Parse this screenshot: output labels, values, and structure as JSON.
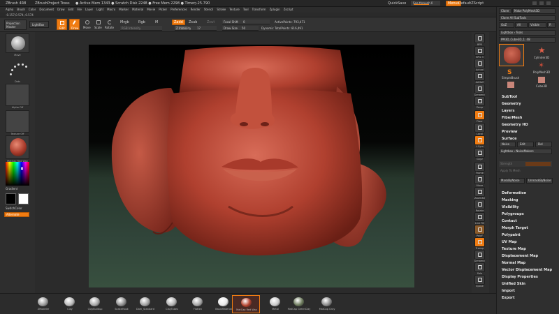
{
  "titlebar": {
    "app": "ZBrush 4R8",
    "project": "ZBrushProject Tosss",
    "stats": "● Active Mem 1343 ● Scratch Disk 2248 ● Free Mem 2298 ● Timer▷25.790",
    "quicksave": "QuickSave",
    "seethrough": "See-through 0",
    "menus_btn": "Menus",
    "defaultscript": "DefaultZScript"
  },
  "menubar": {
    "items": [
      "Alpha",
      "Brush",
      "Color",
      "Document",
      "Draw",
      "Edit",
      "File",
      "Layer",
      "Light",
      "Macro",
      "Marker",
      "Material",
      "Movie",
      "Picker",
      "Preferences",
      "Render",
      "Stencil",
      "Stroke",
      "Texture",
      "Tool",
      "Transform",
      "Zplugin",
      "Zscript"
    ],
    "coords": "-0.157,0.574,-0.574"
  },
  "toolbar": {
    "projection_master": "Projection Master",
    "lightbox": "LightBox",
    "edit": "Edit",
    "draw": "Draw",
    "move": "Move",
    "scale": "Scale",
    "rotate": "Rotate",
    "mrgb": "Mrgb",
    "rgb": "Rgb",
    "m": "M",
    "zadd": "Zadd",
    "zsub": "Zsub",
    "zcut": "Zcut",
    "rgb_intensity": "RGB Intensity",
    "z_intensity_label": "Z Intensity",
    "z_intensity_value": "17",
    "focal_shift_label": "Focal Shift",
    "focal_shift_value": "0",
    "draw_size_label": "Draw Size",
    "draw_size_value": "50",
    "dynamic": "Dynamic",
    "active_points": "ActivePoints: 793,471",
    "total_points": "TotalPoints: 816,491"
  },
  "left_panel": {
    "brush_label": "Move",
    "stroke_label": "Dots",
    "alpha_label": "Alpha Off",
    "texture_label": "Texture Off",
    "material_label": "MatCap Red Wax",
    "gradient": "Gradient",
    "switchcolor": "SwitchColor",
    "alternate": "Alternate"
  },
  "right_icons": [
    {
      "label": "BPR"
    },
    {
      "label": "SPix 3"
    },
    {
      "label": "Actual"
    },
    {
      "label": "AAHalf"
    },
    {
      "label": "Dynamic"
    },
    {
      "label": "Persp"
    },
    {
      "label": "Floor"
    },
    {
      "label": "Local"
    },
    {
      "label": "L.Sym"
    },
    {
      "label": "Gxyz"
    },
    {
      "label": "Frame"
    },
    {
      "label": "Move"
    },
    {
      "label": "Zoom3D"
    },
    {
      "label": "Rotate"
    },
    {
      "label": "Line Fill"
    },
    {
      "label": "PolyF"
    },
    {
      "label": "Transp"
    },
    {
      "label": "Dynamic"
    },
    {
      "label": "Solo"
    },
    {
      "label": "Xpose"
    }
  ],
  "tool_panel": {
    "clone": "Clone",
    "make_polymesh": "Make PolyMesh3D",
    "clone_all": "Clone All SubTools",
    "goz": "GoZ",
    "all": "All",
    "visible": "Visible",
    "r": "R",
    "lightbox_tools": "Lightbox › Tools",
    "current_tool": "PM3D_Cube3D_1. 48",
    "tool_thumbs": [
      "PM3D_Cube3D",
      "Cylinder3D",
      "PolyMesh3D",
      "SimpleBrush",
      "Cube3D",
      "PM3D_Cube3D"
    ]
  },
  "tool_menu": [
    "SubTool",
    "Geometry",
    "Layers",
    "FiberMesh",
    "Geometry HD",
    "Preview",
    "Surface"
  ],
  "surface_panel": {
    "noise": "Noise",
    "edit": "Edit",
    "del": "Del",
    "lightbox_noisemakers": "Lightbox › NoiseMakers",
    "strength": "Strength",
    "apply_to_mesh": "Apply To Mesh",
    "mask_by_noise": "MaskByNoise",
    "unmask_by_noise": "UnmaskByNoise"
  },
  "tool_menu_bottom": [
    "Deformation",
    "Masking",
    "Visibility",
    "Polygroups",
    "Contact",
    "Morph Target",
    "Polypaint",
    "UV Map",
    "Texture Map",
    "Displacement Map",
    "Normal Map",
    "Vector Displacement Map",
    "Display Properties",
    "Unified Skin",
    "Import",
    "Export"
  ],
  "bottom_shelf": [
    {
      "label": "ZModeler",
      "color": "#9a9a9a"
    },
    {
      "label": "Clay",
      "color": "#b8b8b8"
    },
    {
      "label": "ClayBuildup",
      "color": "#a8a8a8"
    },
    {
      "label": "SnakeHook",
      "color": "#8c8c8c"
    },
    {
      "label": "Dam_Standard",
      "color": "#a0a0a0"
    },
    {
      "label": "ClayTubes",
      "color": "#b0b0b0"
    },
    {
      "label": "Flatten",
      "color": "#a5a5a5"
    },
    {
      "label": "BasicMaterial",
      "color": "#e8e8e8"
    },
    {
      "label": "MatCap Red Wax",
      "color": "#b2402c"
    },
    {
      "label": "Metal",
      "color": "#c9c9c9"
    },
    {
      "label": "MatCap GreenClay",
      "color": "#6c7a5c"
    },
    {
      "label": "MatCap Gray",
      "color": "#8a8a8a"
    }
  ],
  "colors": {
    "accent": "#f07c12",
    "wax": "#b04a3a",
    "background_top": "#000000",
    "floor": "#2f4435"
  }
}
